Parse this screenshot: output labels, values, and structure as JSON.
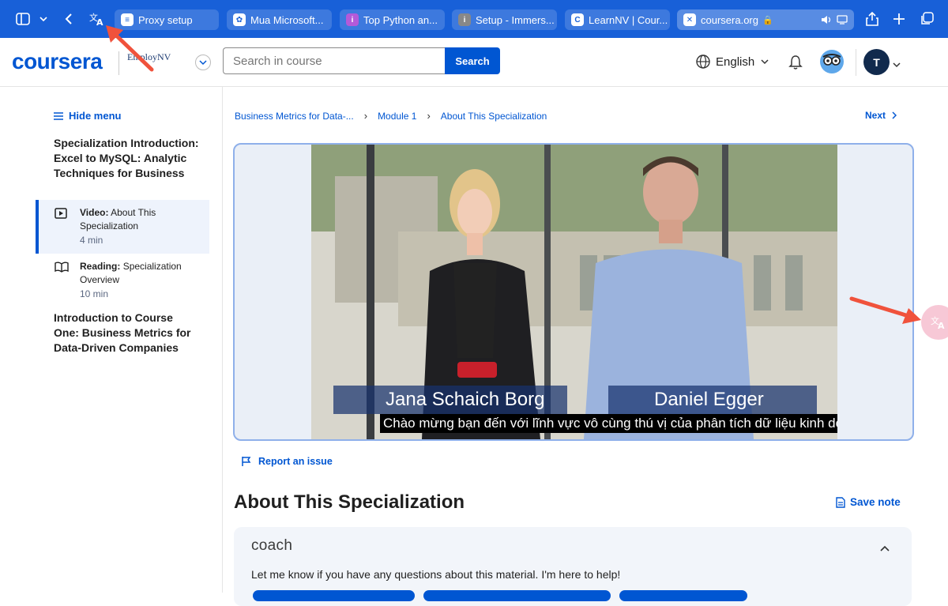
{
  "browser": {
    "tabs": [
      {
        "label": "Proxy setup",
        "icon": "doc-list-icon"
      },
      {
        "label": "Mua Microsoft...",
        "icon": "openai-icon"
      },
      {
        "label": "Top Python an...",
        "icon": "info-icon"
      },
      {
        "label": "Setup - Immers...",
        "icon": "info-icon"
      },
      {
        "label": "LearnNV | Cour...",
        "icon": "c-icon"
      },
      {
        "label": "coursera.org",
        "icon": "lock-icon",
        "active": true
      }
    ]
  },
  "header": {
    "logo": "coursera",
    "partner": "EmployNV",
    "search_placeholder": "Search in course",
    "search_button": "Search",
    "language": "English",
    "avatar_initial": "T"
  },
  "sidebar": {
    "hide_menu": "Hide menu",
    "section1_title": "Specialization Introduction: Excel to MySQL: Analytic Techniques for Business",
    "items": [
      {
        "type": "Video:",
        "title": "About This Specialization",
        "duration": "4 min",
        "current": true
      },
      {
        "type": "Reading:",
        "title": "Specialization Overview",
        "duration": "10 min",
        "current": false
      }
    ],
    "section2_title": "Introduction to Course One: Business Metrics for Data-Driven Companies"
  },
  "breadcrumb": [
    "Business Metrics for Data-...",
    "Module 1",
    "About This Specialization"
  ],
  "next_label": "Next",
  "video": {
    "speaker1": "Jana Schaich Borg",
    "speaker2": "Daniel Egger",
    "caption": "Chào mừng bạn đến với lĩnh vực vô cùng thú vị của phân tích dữ liệu kinh doanh."
  },
  "report_issue": "Report an issue",
  "page_title": "About This Specialization",
  "save_note": "Save note",
  "coach": {
    "title": "coach",
    "message": "Let me know if you have any questions about this material. I'm here to help!"
  },
  "colors": {
    "brand": "#0056d2",
    "browser_bar": "#1860d8",
    "arrow": "#f0523c"
  }
}
